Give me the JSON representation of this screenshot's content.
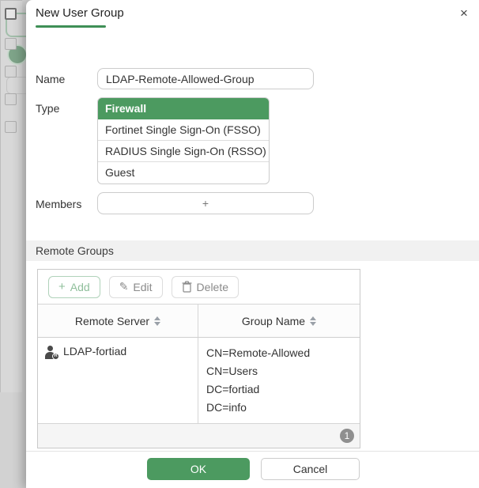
{
  "dialog": {
    "title": "New User Group",
    "close_icon": "×"
  },
  "form": {
    "name": {
      "label": "Name",
      "value": "LDAP-Remote-Allowed-Group"
    },
    "type": {
      "label": "Type",
      "options": [
        {
          "label": "Firewall",
          "selected": true
        },
        {
          "label": "Fortinet Single Sign-On (FSSO)",
          "selected": false
        },
        {
          "label": "RADIUS Single Sign-On (RSSO)",
          "selected": false
        },
        {
          "label": "Guest",
          "selected": false
        }
      ]
    },
    "members": {
      "label": "Members",
      "add_symbol": "+"
    }
  },
  "remote_groups": {
    "section_title": "Remote Groups",
    "toolbar": {
      "add_icon": "+",
      "add_label": "Add",
      "edit_label": "Edit",
      "delete_label": "Delete"
    },
    "columns": [
      {
        "label": "Remote Server"
      },
      {
        "label": "Group Name"
      }
    ],
    "rows": [
      {
        "server": "LDAP-fortiad",
        "server_icon": "remote-user-r-icon",
        "groups": [
          "CN=Remote-Allowed",
          "CN=Users",
          "DC=fortiad",
          "DC=info"
        ]
      }
    ],
    "pagination": {
      "page": "1"
    }
  },
  "footer": {
    "ok_label": "OK",
    "cancel_label": "Cancel"
  },
  "colors": {
    "accent_green": "#4c9a60",
    "underline_green": "#3f8f56",
    "add_button_green": "#8fbf9b",
    "badge_gray": "#8f8f8f"
  }
}
